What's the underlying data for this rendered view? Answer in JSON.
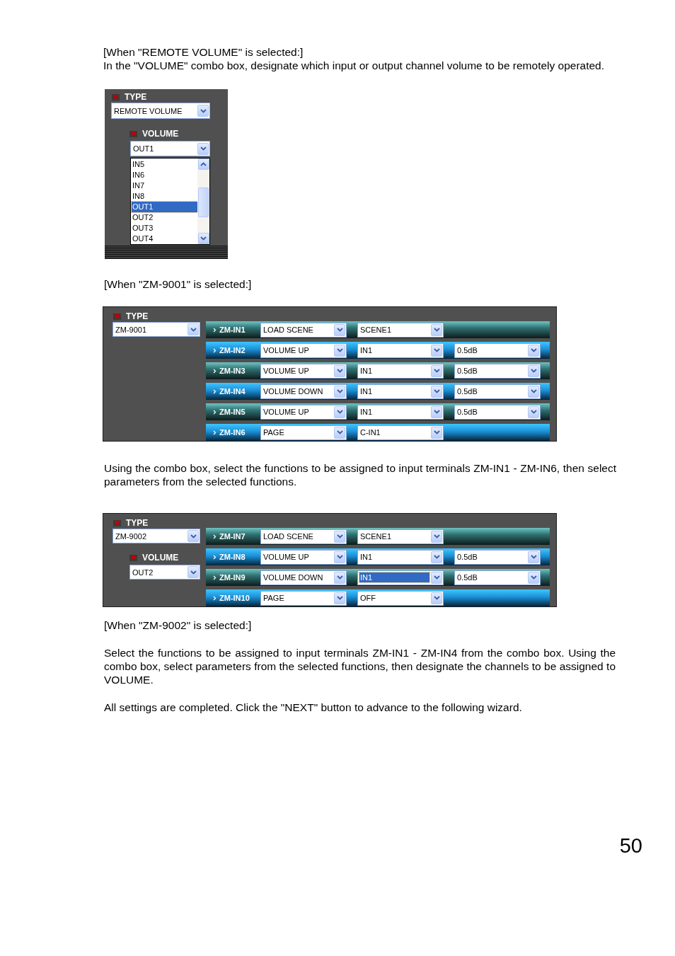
{
  "intro": {
    "heading": "[When \"REMOTE VOLUME\" is selected:]",
    "text": "In the \"VOLUME\" combo box, designate which input or output channel volume to be remotely operated."
  },
  "remote_panel": {
    "type_label": "TYPE",
    "type_value": "REMOTE VOLUME",
    "volume_label": "VOLUME",
    "volume_value": "OUT1",
    "list": [
      {
        "label": "IN5",
        "selected": false
      },
      {
        "label": "IN6",
        "selected": false
      },
      {
        "label": "IN7",
        "selected": false
      },
      {
        "label": "IN8",
        "selected": false
      },
      {
        "label": "OUT1",
        "selected": true
      },
      {
        "label": "OUT2",
        "selected": false
      },
      {
        "label": "OUT3",
        "selected": false
      },
      {
        "label": "OUT4",
        "selected": false
      }
    ]
  },
  "caption_9001": "[When \"ZM-9001\" is selected:]",
  "panel_9001": {
    "type_label": "TYPE",
    "type_value": "ZM-9001",
    "rows": [
      {
        "terminal": "ZM-IN1",
        "combos": [
          {
            "value": "LOAD SCENE",
            "focused": false
          },
          {
            "value": "SCENE1",
            "focused": false
          }
        ]
      },
      {
        "terminal": "ZM-IN2",
        "combos": [
          {
            "value": "VOLUME UP",
            "focused": false
          },
          {
            "value": "IN1",
            "focused": false
          },
          {
            "value": "0.5dB",
            "focused": false
          }
        ]
      },
      {
        "terminal": "ZM-IN3",
        "combos": [
          {
            "value": "VOLUME UP",
            "focused": false
          },
          {
            "value": "IN1",
            "focused": false
          },
          {
            "value": "0.5dB",
            "focused": false
          }
        ]
      },
      {
        "terminal": "ZM-IN4",
        "combos": [
          {
            "value": "VOLUME DOWN",
            "focused": false
          },
          {
            "value": "IN1",
            "focused": false
          },
          {
            "value": "0.5dB",
            "focused": false
          }
        ]
      },
      {
        "terminal": "ZM-IN5",
        "combos": [
          {
            "value": "VOLUME UP",
            "focused": false
          },
          {
            "value": "IN1",
            "focused": false
          },
          {
            "value": "0.5dB",
            "focused": false
          }
        ]
      },
      {
        "terminal": "ZM-IN6",
        "combos": [
          {
            "value": "PAGE",
            "focused": false
          },
          {
            "value": "C-IN1",
            "focused": false
          }
        ]
      }
    ]
  },
  "text_9001": "Using the combo box, select the functions to be assigned to input terminals ZM-IN1 - ZM-IN6, then select parameters from the selected functions.",
  "panel_9002": {
    "type_label": "TYPE",
    "type_value": "ZM-9002",
    "volume_label": "VOLUME",
    "volume_value": "OUT2",
    "rows": [
      {
        "terminal": "ZM-IN7",
        "combos": [
          {
            "value": "LOAD SCENE",
            "focused": false
          },
          {
            "value": "SCENE1",
            "focused": false
          }
        ]
      },
      {
        "terminal": "ZM-IN8",
        "combos": [
          {
            "value": "VOLUME UP",
            "focused": false
          },
          {
            "value": "IN1",
            "focused": false
          },
          {
            "value": "0.5dB",
            "focused": false
          }
        ]
      },
      {
        "terminal": "ZM-IN9",
        "combos": [
          {
            "value": "VOLUME DOWN",
            "focused": false
          },
          {
            "value": "IN1",
            "focused": true
          },
          {
            "value": "0.5dB",
            "focused": false
          }
        ]
      },
      {
        "terminal": "ZM-IN10",
        "combos": [
          {
            "value": "PAGE",
            "focused": false
          },
          {
            "value": "OFF",
            "focused": false
          }
        ]
      }
    ]
  },
  "caption_9002": "[When \"ZM-9002\" is selected:]",
  "text_9002": "Select the functions to be assigned to input terminals ZM-IN1 - ZM-IN4 from the combo box. Using the combo box, select parameters from the selected functions, then designate the channels to be assigned to VOLUME.",
  "closing": "All settings are completed. Click the \"NEXT\" button to advance to the following wizard.",
  "page_number": "50"
}
